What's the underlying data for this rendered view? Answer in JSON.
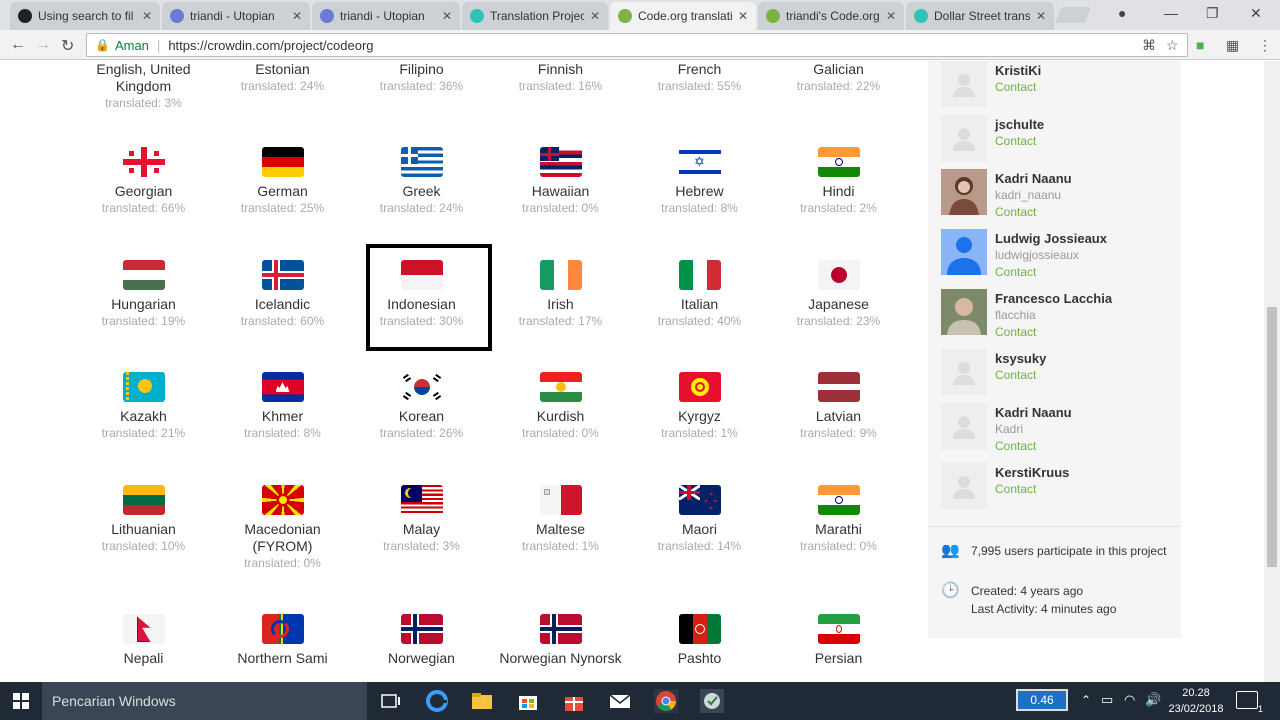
{
  "browser": {
    "tabs": [
      {
        "title": "Using search to fil",
        "favicon_color": "#222222"
      },
      {
        "title": "triandi - Utopian",
        "favicon_color": "#6b7bd8"
      },
      {
        "title": "triandi - Utopian",
        "favicon_color": "#6b7bd8"
      },
      {
        "title": "Translation Project",
        "favicon_color": "#2ec4b6"
      },
      {
        "title": "Code.org translati",
        "favicon_color": "#7cb342",
        "active": true
      },
      {
        "title": "triandi's Code.org",
        "favicon_color": "#7cb342"
      },
      {
        "title": "Dollar Street trans",
        "favicon_color": "#2ec4b6"
      }
    ],
    "security_label": "Aman",
    "url": "https://crowdin.com/project/codeorg"
  },
  "languages": [
    {
      "name": "English, United Kingdom",
      "translated": "translated: 3%"
    },
    {
      "name": "Estonian",
      "translated": "translated: 24%"
    },
    {
      "name": "Filipino",
      "translated": "translated: 36%"
    },
    {
      "name": "Finnish",
      "translated": "translated: 16%"
    },
    {
      "name": "French",
      "translated": "translated: 55%"
    },
    {
      "name": "Galician",
      "translated": "translated: 22%"
    },
    {
      "name": "Georgian",
      "translated": "translated: 66%"
    },
    {
      "name": "German",
      "translated": "translated: 25%"
    },
    {
      "name": "Greek",
      "translated": "translated: 24%"
    },
    {
      "name": "Hawaiian",
      "translated": "translated: 0%"
    },
    {
      "name": "Hebrew",
      "translated": "translated: 8%"
    },
    {
      "name": "Hindi",
      "translated": "translated: 2%"
    },
    {
      "name": "Hungarian",
      "translated": "translated: 19%"
    },
    {
      "name": "Icelandic",
      "translated": "translated: 60%"
    },
    {
      "name": "Indonesian",
      "translated": "translated: 30%"
    },
    {
      "name": "Irish",
      "translated": "translated: 17%"
    },
    {
      "name": "Italian",
      "translated": "translated: 40%"
    },
    {
      "name": "Japanese",
      "translated": "translated: 23%"
    },
    {
      "name": "Kazakh",
      "translated": "translated: 21%"
    },
    {
      "name": "Khmer",
      "translated": "translated: 8%"
    },
    {
      "name": "Korean",
      "translated": "translated: 26%"
    },
    {
      "name": "Kurdish",
      "translated": "translated: 0%"
    },
    {
      "name": "Kyrgyz",
      "translated": "translated: 1%"
    },
    {
      "name": "Latvian",
      "translated": "translated: 9%"
    },
    {
      "name": "Lithuanian",
      "translated": "translated: 10%"
    },
    {
      "name": "Macedonian (FYROM)",
      "translated": "translated: 0%"
    },
    {
      "name": "Malay",
      "translated": "translated: 3%"
    },
    {
      "name": "Maltese",
      "translated": "translated: 1%"
    },
    {
      "name": "Maori",
      "translated": "translated: 14%"
    },
    {
      "name": "Marathi",
      "translated": "translated: 0%"
    },
    {
      "name": "Nepali",
      "translated": ""
    },
    {
      "name": "Northern Sami",
      "translated": ""
    },
    {
      "name": "Norwegian",
      "translated": ""
    },
    {
      "name": "Norwegian Nynorsk",
      "translated": ""
    },
    {
      "name": "Pashto",
      "translated": ""
    },
    {
      "name": "Persian",
      "translated": ""
    }
  ],
  "members": [
    {
      "name": "KristiKi",
      "login": "",
      "contact": "Contact"
    },
    {
      "name": "jschulte",
      "login": "",
      "contact": "Contact"
    },
    {
      "name": "Kadri Naanu",
      "login": "kadri_naanu",
      "contact": "Contact"
    },
    {
      "name": "Ludwig Jossieaux",
      "login": "ludwigjossieaux",
      "contact": "Contact"
    },
    {
      "name": "Francesco Lacchia",
      "login": "flacchia",
      "contact": "Contact"
    },
    {
      "name": "ksysuky",
      "login": "",
      "contact": "Contact"
    },
    {
      "name": "Kadri Naanu",
      "login": "Kadri",
      "contact": "Contact"
    },
    {
      "name": "KerstiKruus",
      "login": "",
      "contact": "Contact"
    }
  ],
  "project_stats": {
    "participants": "7,995 users participate in this project",
    "created": "Created: 4 years ago",
    "last_activity": "Last Activity: 4 minutes ago"
  },
  "taskbar": {
    "search_placeholder": "Pencarian Windows",
    "net_meter": "0.46",
    "time": "20.28",
    "date": "23/02/2018",
    "notification_count": "1"
  }
}
